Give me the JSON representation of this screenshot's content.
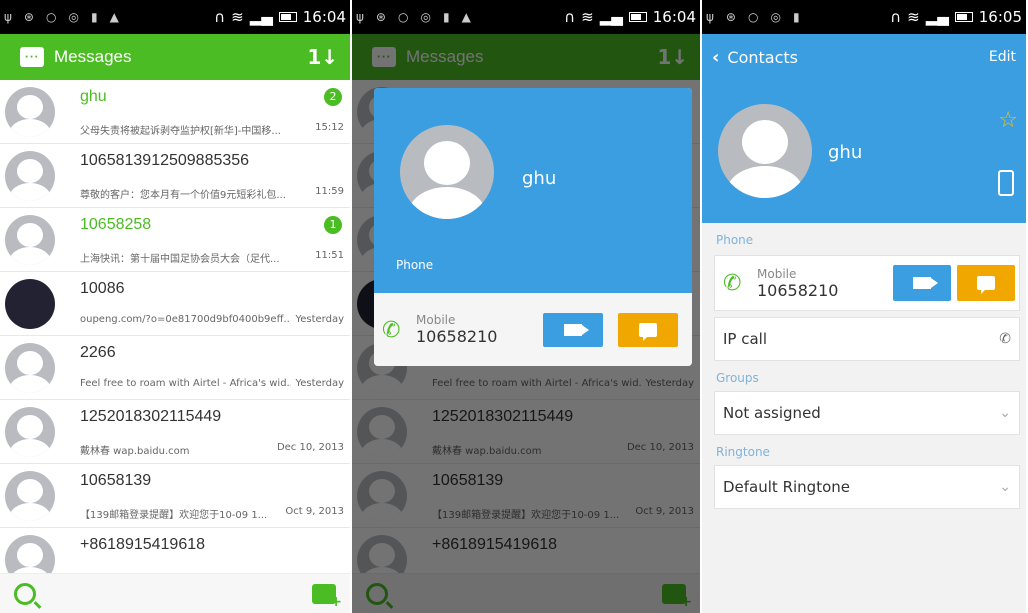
{
  "status": {
    "time1": "16:04",
    "time2": "16:04",
    "time3": "16:05"
  },
  "messages": {
    "title": "Messages",
    "items": [
      {
        "name": "ghu",
        "preview": "父母失责将被起诉剥夺监护权[新华]-中国移...",
        "time": "15:12",
        "badge": "2",
        "unread": true
      },
      {
        "name": "1065813912509885356",
        "preview": "尊敬的客户：您本月有一个价值9元短彩礼包...",
        "time": "11:59",
        "badge": "",
        "unread": false
      },
      {
        "name": "10658258",
        "preview": "上海快讯：第十届中国足协会员大会（足代...",
        "time": "11:51",
        "badge": "1",
        "unread": true
      },
      {
        "name": "10086",
        "preview": "oupeng.com/?o=0e81700d9bf0400b9eff...",
        "time": "Yesterday",
        "badge": "",
        "unread": false,
        "photo": true
      },
      {
        "name": "2266",
        "preview": "Feel free to roam with Airtel - Africa's wid...",
        "time": "Yesterday",
        "badge": "",
        "unread": false
      },
      {
        "name": "1252018302115449",
        "preview": "戴林春 wap.baidu.com",
        "time": "Dec 10, 2013",
        "badge": "",
        "unread": false
      },
      {
        "name": "10658139",
        "preview": "【139邮箱登录提醒】欢迎您于10-09 1...",
        "time": "Oct 9, 2013",
        "badge": "",
        "unread": false
      },
      {
        "name": "+8618915419618",
        "preview": "",
        "time": "",
        "badge": "",
        "unread": false
      }
    ]
  },
  "popup": {
    "name": "ghu",
    "section": "Phone",
    "mobile_label": "Mobile",
    "mobile_number": "10658210"
  },
  "contact": {
    "back_title": "Contacts",
    "edit": "Edit",
    "name": "ghu",
    "phone_section": "Phone",
    "mobile_label": "Mobile",
    "mobile_number": "10658210",
    "ip_call": "IP call",
    "groups_section": "Groups",
    "groups_value": "Not assigned",
    "ringtone_section": "Ringtone",
    "ringtone_value": "Default Ringtone"
  },
  "colors": {
    "green": "#4cbc24",
    "blue": "#3a9ee0",
    "orange": "#f0a800"
  }
}
